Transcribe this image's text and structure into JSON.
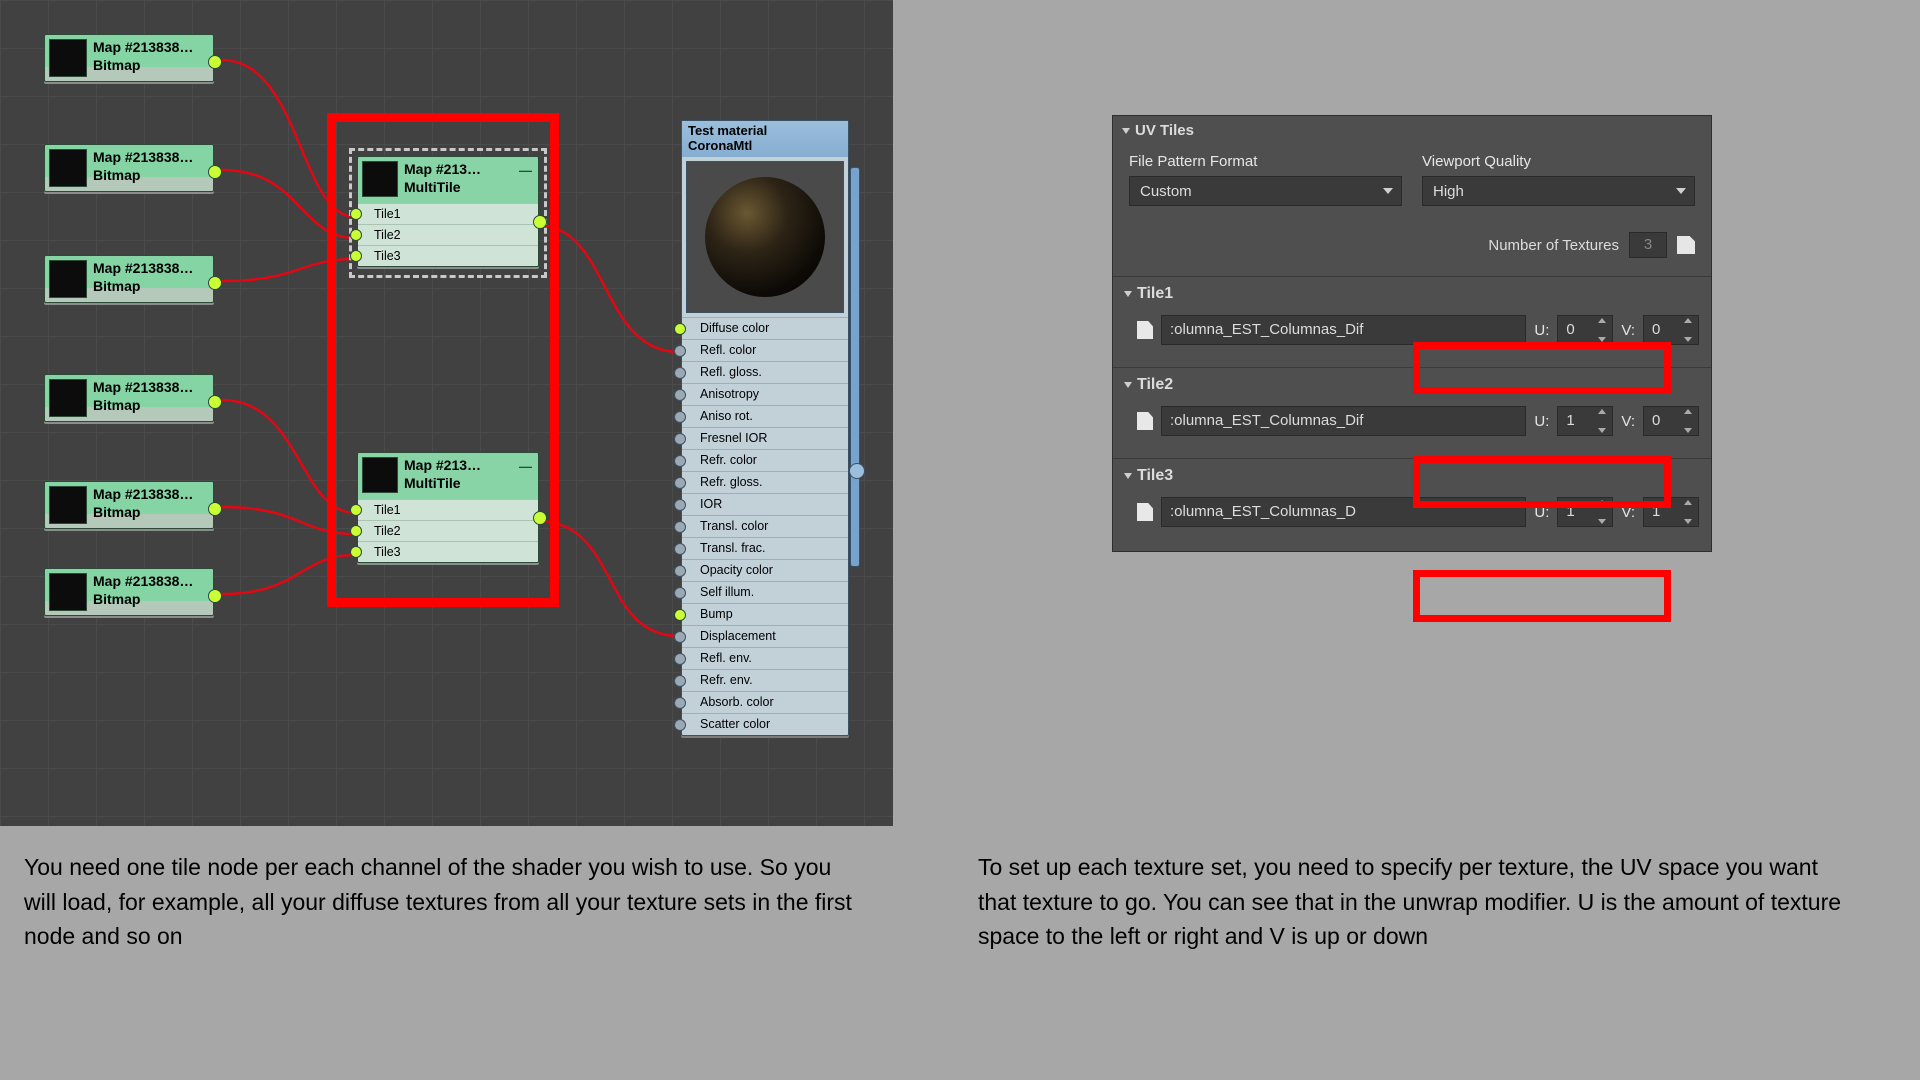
{
  "graph": {
    "bitmaps": [
      {
        "title": "Map #213838…",
        "sub": "Bitmap"
      },
      {
        "title": "Map #213838…",
        "sub": "Bitmap"
      },
      {
        "title": "Map #213838…",
        "sub": "Bitmap"
      },
      {
        "title": "Map #213838…",
        "sub": "Bitmap"
      },
      {
        "title": "Map #213838…",
        "sub": "Bitmap"
      },
      {
        "title": "Map #213838…",
        "sub": "Bitmap"
      }
    ],
    "multitile": [
      {
        "title": "Map #213…",
        "sub": "MultiTile",
        "tiles": [
          "Tile1",
          "Tile2",
          "Tile3"
        ]
      },
      {
        "title": "Map #213…",
        "sub": "MultiTile",
        "tiles": [
          "Tile1",
          "Tile2",
          "Tile3"
        ]
      }
    ],
    "material": {
      "name": "Test material",
      "type": "CoronaMtl",
      "slots": [
        "Diffuse color",
        "Refl. color",
        "Refl. gloss.",
        "Anisotropy",
        "Aniso rot.",
        "Fresnel IOR",
        "Refr. color",
        "Refr. gloss.",
        "IOR",
        "Transl. color",
        "Transl. frac.",
        "Opacity color",
        "Self illum.",
        "Bump",
        "Displacement",
        "Refl. env.",
        "Refr. env.",
        "Absorb. color",
        "Scatter color"
      ]
    }
  },
  "panel": {
    "title": "UV Tiles",
    "pattern_label": "File Pattern Format",
    "pattern_value": "Custom",
    "quality_label": "Viewport Quality",
    "quality_value": "High",
    "numtex_label": "Number of Textures",
    "numtex_value": "3",
    "tiles": [
      {
        "name": "Tile1",
        "file": ":olumna_EST_Columnas_Dif",
        "u": "0",
        "v": "0"
      },
      {
        "name": "Tile2",
        "file": ":olumna_EST_Columnas_Dif",
        "u": "1",
        "v": "0"
      },
      {
        "name": "Tile3",
        "file": ":olumna_EST_Columnas_D",
        "u": "1",
        "v": "1"
      }
    ],
    "labels": {
      "u": "U:",
      "v": "V:"
    }
  },
  "captions": {
    "left": "You need one tile node per each channel of the shader you wish to use. So you will load, for example, all your diffuse textures from all your texture sets in the first node and so on",
    "right": "To set up each texture set, you need to specify per texture, the  UV space you want that texture to go. You can see that in the unwrap modifier. U is the amount of texture space to the left or right and V is up or down"
  }
}
